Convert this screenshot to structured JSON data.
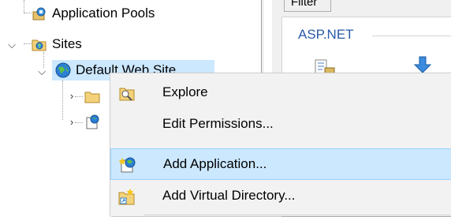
{
  "tree": {
    "app_pools_label": "Application Pools",
    "sites_label": "Sites",
    "default_site_label": "Default Web Site"
  },
  "right_panel": {
    "filter_tab_label": "Filter",
    "group_title": "ASP.NET"
  },
  "context_menu": {
    "items": [
      {
        "label": "Explore",
        "icon": "folder-explore-icon"
      },
      {
        "label": "Edit Permissions...",
        "icon": ""
      },
      {
        "label": "Add Application...",
        "icon": "add-application-icon",
        "highlighted": true
      },
      {
        "label": "Add Virtual Directory...",
        "icon": "add-virtual-directory-icon"
      }
    ]
  },
  "colors": {
    "selection": "#cce8ff",
    "highlight_border": "#99d1ff",
    "group_title": "#2a5aa8",
    "menu_bg": "#f2f2f2"
  }
}
